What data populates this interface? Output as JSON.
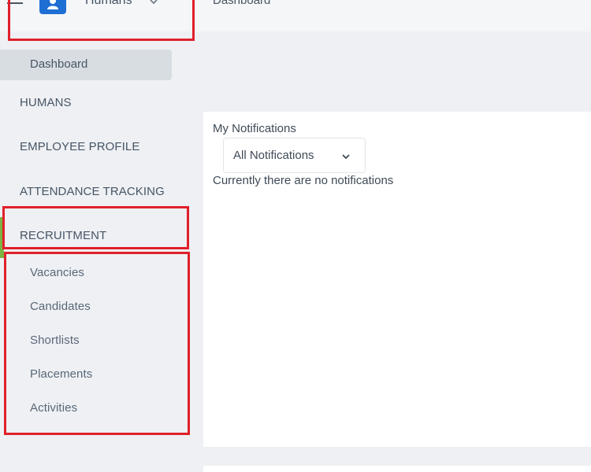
{
  "header": {
    "app_name": "Humans",
    "breadcrumb": "Dashboard",
    "icons": {
      "menu": "hamburger-icon",
      "logo": "user-icon",
      "chevron": "chevron-down-icon"
    }
  },
  "sidebar": {
    "active_item": "Dashboard",
    "sections": [
      {
        "label": "HUMANS"
      },
      {
        "label": "EMPLOYEE PROFILE"
      },
      {
        "label": "ATTENDANCE TRACKING"
      },
      {
        "label": "RECRUITMENT"
      }
    ],
    "recruitment_items": [
      "Vacancies",
      "Candidates",
      "Shortlists",
      "Placements",
      "Activities"
    ]
  },
  "main": {
    "notifications_title": "My Notifications",
    "filter_selected": "All Notifications",
    "empty_message": "Currently there are no notifications"
  },
  "colors": {
    "highlight": "#e0202a",
    "brand": "#1f6ed4",
    "active_marker": "#7cb342"
  }
}
